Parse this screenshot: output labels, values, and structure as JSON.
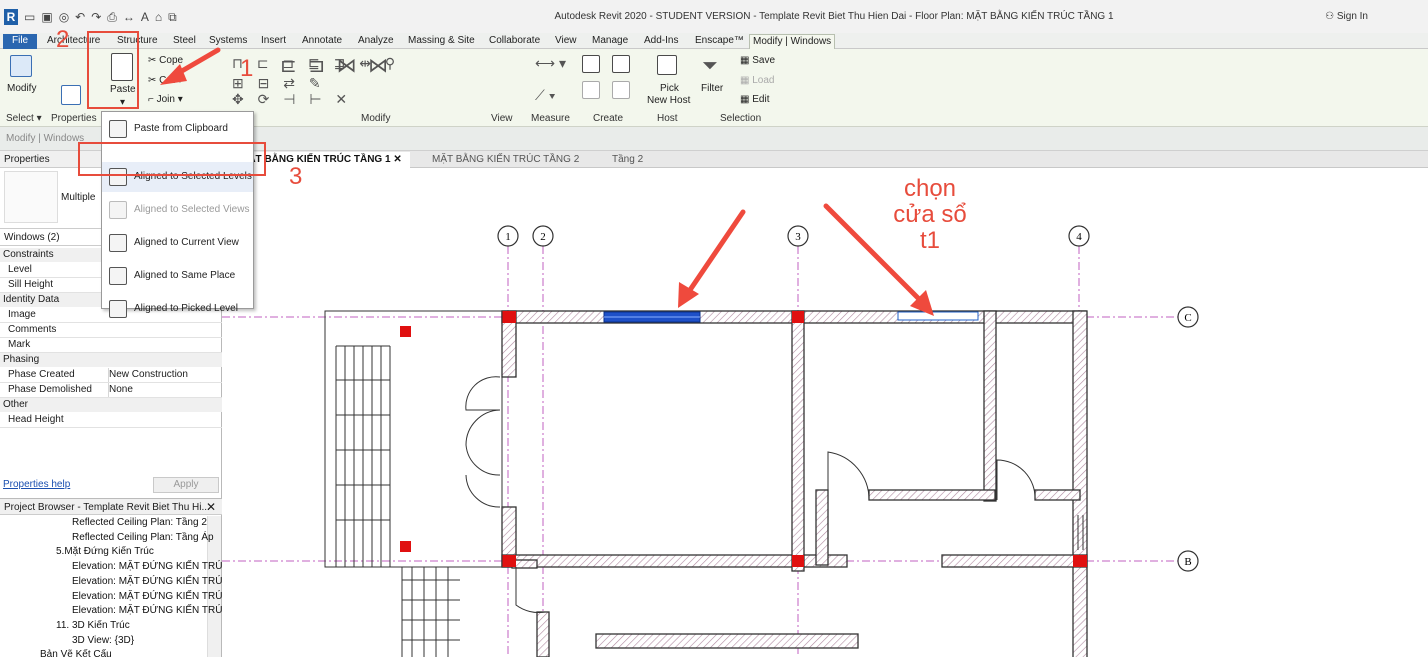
{
  "window": {
    "title": "Autodesk Revit 2020 - STUDENT VERSION - Template Revit Biet Thu Hien Dai - Floor Plan: MẶT BẰNG KIẾN TRÚC TẦNG 1",
    "app_icon": "R",
    "sign_in": "Sign In"
  },
  "tabs": [
    "File",
    "Architecture",
    "Structure",
    "Steel",
    "Systems",
    "Insert",
    "Annotate",
    "Analyze",
    "Massing & Site",
    "Collaborate",
    "View",
    "Manage",
    "Add-Ins",
    "Enscape™",
    "Modify | Windows"
  ],
  "ribbon": {
    "modify": "Modify",
    "paste": "Paste",
    "cut": "Cut",
    "join": "Join",
    "cope": "Cope",
    "pick_new_host": [
      "Pick",
      "New Host"
    ],
    "filter": "Filter",
    "save": "Save",
    "load": "Load",
    "edit": "Edit",
    "groups": [
      "Select ▾",
      "Properties",
      "Modify",
      "View",
      "Measure",
      "Create",
      "Host",
      "Selection"
    ]
  },
  "options_bar": "Modify | Windows",
  "paste_menu": [
    {
      "label": "Paste from Clipboard",
      "enabled": true,
      "icon": "clipboard-icon"
    },
    {
      "label": "Aligned to Selected Levels",
      "enabled": true,
      "icon": "align-levels-icon"
    },
    {
      "label": "Aligned to Selected Views",
      "enabled": false,
      "icon": "align-views-icon"
    },
    {
      "label": "Aligned to Current View",
      "enabled": true,
      "icon": "align-current-view-icon"
    },
    {
      "label": "Aligned to Same Place",
      "enabled": true,
      "icon": "align-same-place-icon"
    },
    {
      "label": "Aligned to Picked Level",
      "enabled": true,
      "icon": "align-picked-level-icon"
    }
  ],
  "properties": {
    "title": "Properties",
    "type_label": "Multiple",
    "selector": "Windows (2)",
    "sections": [
      {
        "name": "Constraints",
        "rows": [
          {
            "k": "Level",
            "v": ""
          },
          {
            "k": "Sill Height",
            "v": ""
          }
        ]
      },
      {
        "name": "Identity Data",
        "rows": [
          {
            "k": "Image",
            "v": ""
          },
          {
            "k": "Comments",
            "v": ""
          },
          {
            "k": "Mark",
            "v": ""
          }
        ]
      },
      {
        "name": "Phasing",
        "rows": [
          {
            "k": "Phase Created",
            "v": "New Construction"
          },
          {
            "k": "Phase Demolished",
            "v": "None"
          }
        ]
      },
      {
        "name": "Other",
        "rows": [
          {
            "k": "Head Height",
            "v": ""
          }
        ]
      }
    ],
    "help": "Properties help",
    "apply": "Apply"
  },
  "project_browser": {
    "title": "Project Browser - Template Revit Biet Thu Hi...",
    "items": [
      "Reflected Ceiling Plan: Tầng 2",
      "Reflected Ceiling Plan: Tầng Áp",
      "5.Mặt Đứng Kiến Trúc",
      "Elevation: MẶT ĐỨNG KIẾN TRÚ",
      "Elevation: MẶT ĐỨNG KIẾN TRÚ",
      "Elevation: MẶT ĐỨNG KIẾN TRÚ",
      "Elevation: MẶT ĐỨNG KIẾN TRÚ",
      "11. 3D Kiến Trúc",
      "3D View: {3D}",
      "Bản Vẽ Kết Cấu"
    ]
  },
  "view_tabs": [
    {
      "label": "MẶT BẰNG KIẾN TRÚC TẦNG 1",
      "active": true
    },
    {
      "label": "MẶT BẰNG KIẾN TRÚC TẦNG 2",
      "active": false
    },
    {
      "label": "Tầng 2",
      "active": false
    }
  ],
  "grid_labels": [
    "1",
    "2",
    "3",
    "4",
    "C",
    "B"
  ],
  "annotations": {
    "step1": "1",
    "step2": "2",
    "step3": "3",
    "note": [
      "chọn",
      "cửa sổ",
      "t1"
    ]
  },
  "colors": {
    "annotation": "#e74c3c",
    "selected_window": "#1e50c8",
    "grid": "#c060c0"
  }
}
